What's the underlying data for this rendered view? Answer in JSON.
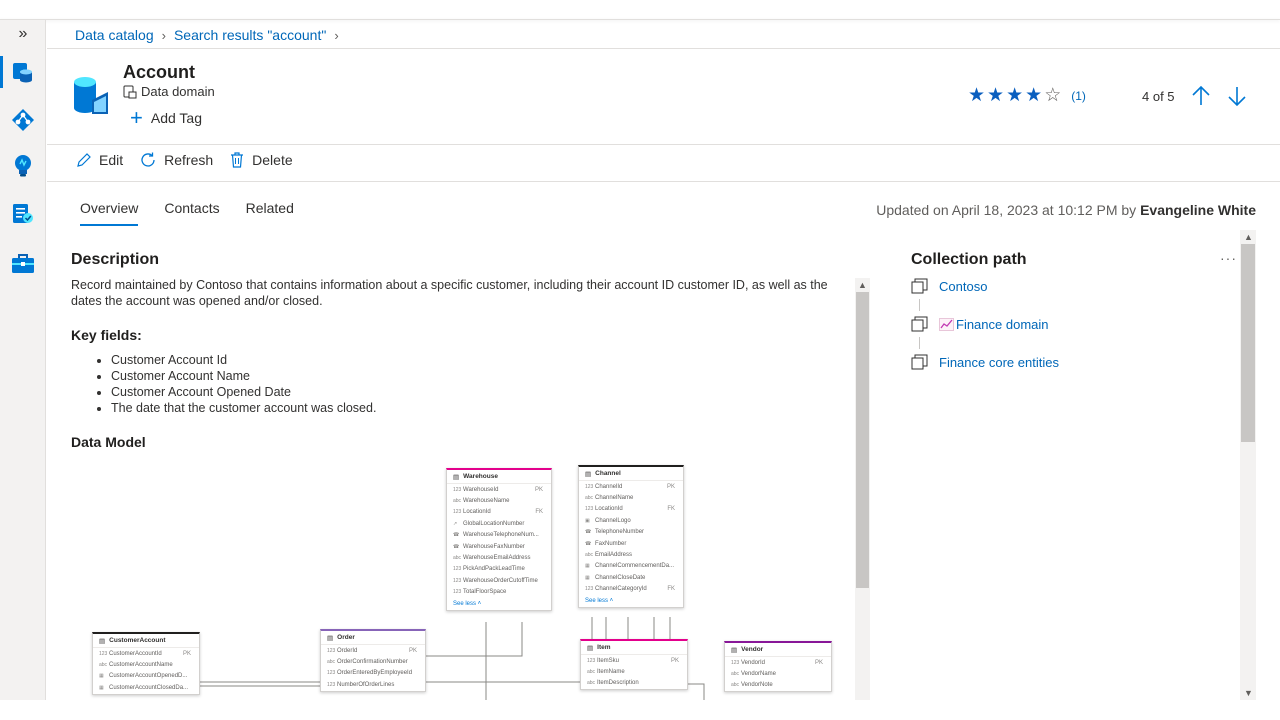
{
  "breadcrumb": [
    {
      "label": "Data catalog"
    },
    {
      "label": "Search results \"account\""
    }
  ],
  "rail": {
    "toggle_label": "»",
    "items": [
      {
        "icon": "data-catalog-icon",
        "active": true
      },
      {
        "icon": "data-map-icon",
        "active": false
      },
      {
        "icon": "insights-icon",
        "active": false
      },
      {
        "icon": "policy-icon",
        "active": false
      },
      {
        "icon": "management-toolbox-icon",
        "active": false
      }
    ]
  },
  "header": {
    "title": "Account",
    "subtitle": "Data domain",
    "add_tag_label": "Add Tag",
    "rating": {
      "value": 4,
      "max": 5,
      "count_label": "(1)"
    },
    "pager_label": "4 of 5"
  },
  "toolbar": {
    "edit_label": "Edit",
    "refresh_label": "Refresh",
    "delete_label": "Delete"
  },
  "tabs": [
    {
      "label": "Overview",
      "active": true
    },
    {
      "label": "Contacts",
      "active": false
    },
    {
      "label": "Related",
      "active": false
    }
  ],
  "updated": {
    "prefix": "Updated on April 18, 2023 at 10:12 PM by ",
    "user": "Evangeline White"
  },
  "overview": {
    "description_heading": "Description",
    "description": "Record maintained by Contoso that contains information about a specific customer, including their account ID customer ID, as well as the dates the account was opened and/or closed.",
    "key_fields_heading": "Key fields:",
    "key_fields": [
      "Customer Account Id",
      "Customer Account Name",
      "Customer Account Opened Date",
      "The date that the customer account was closed."
    ],
    "data_model_heading": "Data Model"
  },
  "data_model": {
    "tables": [
      {
        "name": "Warehouse",
        "accent": "#e3008c",
        "see_less": "See less",
        "fields": [
          {
            "type": "123",
            "name": "WarehouseId",
            "key": "PK"
          },
          {
            "type": "abc",
            "name": "WarehouseName",
            "key": ""
          },
          {
            "type": "123",
            "name": "LocationId",
            "key": "FK"
          },
          {
            "type": "loc",
            "name": "GlobalLocationNumber",
            "key": ""
          },
          {
            "type": "tel",
            "name": "WarehouseTelephoneNum...",
            "key": ""
          },
          {
            "type": "tel",
            "name": "WarehouseFaxNumber",
            "key": ""
          },
          {
            "type": "abc",
            "name": "WarehouseEmailAddress",
            "key": ""
          },
          {
            "type": "123",
            "name": "PickAndPackLeadTime",
            "key": ""
          },
          {
            "type": "123",
            "name": "WarehouseOrderCutoffTime",
            "key": ""
          },
          {
            "type": "123",
            "name": "TotalFloorSpace",
            "key": ""
          }
        ]
      },
      {
        "name": "Channel",
        "accent": "#201f1e",
        "see_less": "See less",
        "fields": [
          {
            "type": "123",
            "name": "ChannelId",
            "key": "PK"
          },
          {
            "type": "abc",
            "name": "ChannelName",
            "key": ""
          },
          {
            "type": "123",
            "name": "LocationId",
            "key": "FK"
          },
          {
            "type": "img",
            "name": "ChannelLogo",
            "key": ""
          },
          {
            "type": "tel",
            "name": "TelephoneNumber",
            "key": ""
          },
          {
            "type": "tel",
            "name": "FaxNumber",
            "key": ""
          },
          {
            "type": "abc",
            "name": "EmailAddress",
            "key": ""
          },
          {
            "type": "cal",
            "name": "ChannelCommencementDa...",
            "key": ""
          },
          {
            "type": "cal",
            "name": "ChannelCloseDate",
            "key": ""
          },
          {
            "type": "123",
            "name": "ChannelCategoryId",
            "key": "FK"
          }
        ]
      },
      {
        "name": "CustomerAccount",
        "accent": "#201f1e",
        "fields": [
          {
            "type": "123",
            "name": "CustomerAccountId",
            "key": "PK"
          },
          {
            "type": "abc",
            "name": "CustomerAccountName",
            "key": ""
          },
          {
            "type": "cal",
            "name": "CustomerAccountOpenedD...",
            "key": ""
          },
          {
            "type": "cal",
            "name": "CustomerAccountClosedDa...",
            "key": ""
          }
        ]
      },
      {
        "name": "Order",
        "accent": "#8764b8",
        "fields": [
          {
            "type": "123",
            "name": "OrderId",
            "key": "PK"
          },
          {
            "type": "abc",
            "name": "OrderConfirmationNumber",
            "key": ""
          },
          {
            "type": "123",
            "name": "OrderEnteredByEmployeeId",
            "key": ""
          },
          {
            "type": "123",
            "name": "NumberOfOrderLines",
            "key": ""
          }
        ]
      },
      {
        "name": "Item",
        "accent": "#e3008c",
        "fields": [
          {
            "type": "123",
            "name": "ItemSku",
            "key": "PK"
          },
          {
            "type": "abc",
            "name": "ItemName",
            "key": ""
          },
          {
            "type": "abc",
            "name": "ItemDescription",
            "key": ""
          }
        ]
      },
      {
        "name": "Vendor",
        "accent": "#881798",
        "fields": [
          {
            "type": "123",
            "name": "VendorId",
            "key": "PK"
          },
          {
            "type": "abc",
            "name": "VendorName",
            "key": ""
          },
          {
            "type": "abc",
            "name": "VendorNote",
            "key": ""
          }
        ]
      }
    ]
  },
  "collection": {
    "heading": "Collection path",
    "more_label": "···",
    "items": [
      {
        "label": "Contoso",
        "icon": "collection-icon"
      },
      {
        "label": "Finance domain",
        "icon": "collection-icon",
        "emoji": "chart-icon"
      },
      {
        "label": "Finance core entities",
        "icon": "collection-icon"
      }
    ]
  },
  "colors": {
    "accent": "#0078d4",
    "link": "#0067b8",
    "star": "#0b5fbf"
  }
}
